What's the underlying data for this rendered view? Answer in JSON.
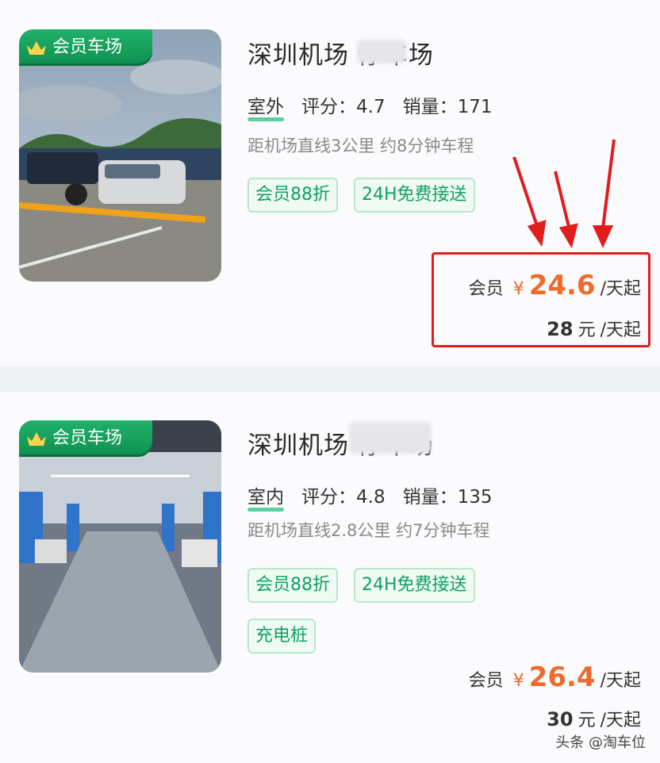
{
  "lots": [
    {
      "badge": "会员车场",
      "name": "深圳机场 停车场",
      "kind": "室外",
      "rating_label": "评分：",
      "rating": "4.7",
      "sales_label": "销量：",
      "sales": "171",
      "distance": "距机场直线3公里 约8分钟车程",
      "tags": [
        "会员88折",
        "24H免费接送"
      ],
      "member_label": "会员",
      "currency": "¥",
      "member_price": "24.6",
      "unit": "/天起",
      "regular_price": "28",
      "regular_unit": "元"
    },
    {
      "badge": "会员车场",
      "name": "深圳机场 停车场",
      "kind": "室内",
      "rating_label": "评分：",
      "rating": "4.8",
      "sales_label": "销量：",
      "sales": "135",
      "distance": "距机场直线2.8公里 约7分钟车程",
      "tags": [
        "会员88折",
        "24H免费接送",
        "充电桩"
      ],
      "member_label": "会员",
      "currency": "¥",
      "member_price": "26.4",
      "unit": "/天起",
      "regular_price": "30",
      "regular_unit": "元"
    }
  ],
  "watermark": "头条 @淘车位",
  "colors": {
    "accent": "#ef6a2c",
    "brand_green": "#10a163",
    "highlight": "#e11d1d"
  }
}
